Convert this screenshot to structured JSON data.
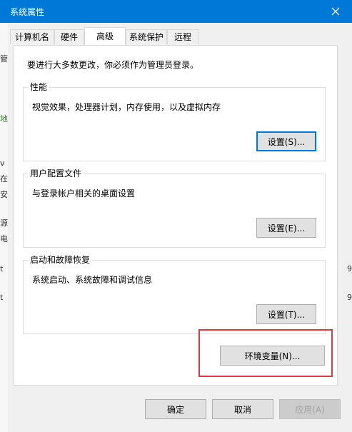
{
  "window": {
    "title": "系统属性"
  },
  "background_fragments": {
    "left": [
      "管",
      "地",
      "v",
      "在",
      "安",
      "源",
      "电",
      "t",
      "t"
    ],
    "right": [
      "9",
      "9"
    ]
  },
  "tabs": [
    {
      "label": "计算机名"
    },
    {
      "label": "硬件"
    },
    {
      "label": "高级",
      "active": true
    },
    {
      "label": "系统保护"
    },
    {
      "label": "远程"
    }
  ],
  "advanced": {
    "admin_notice": "要进行大多数更改，你必须作为管理员登录。",
    "performance": {
      "title": "性能",
      "description": "视觉效果，处理器计划，内存使用，以及虚拟内存",
      "button": "设置(S)..."
    },
    "user_profiles": {
      "title": "用户配置文件",
      "description": "与登录帐户相关的桌面设置",
      "button": "设置(E)..."
    },
    "startup_recovery": {
      "title": "启动和故障恢复",
      "description": "系统启动、系统故障和调试信息",
      "button": "设置(T)..."
    },
    "env_vars_button": "环境变量(N)..."
  },
  "footer": {
    "ok": "确定",
    "cancel": "取消",
    "apply": "应用(A)"
  },
  "colors": {
    "titlebar": "#0078d7",
    "focus": "#0078d7",
    "highlight_box": "#e0393e"
  }
}
